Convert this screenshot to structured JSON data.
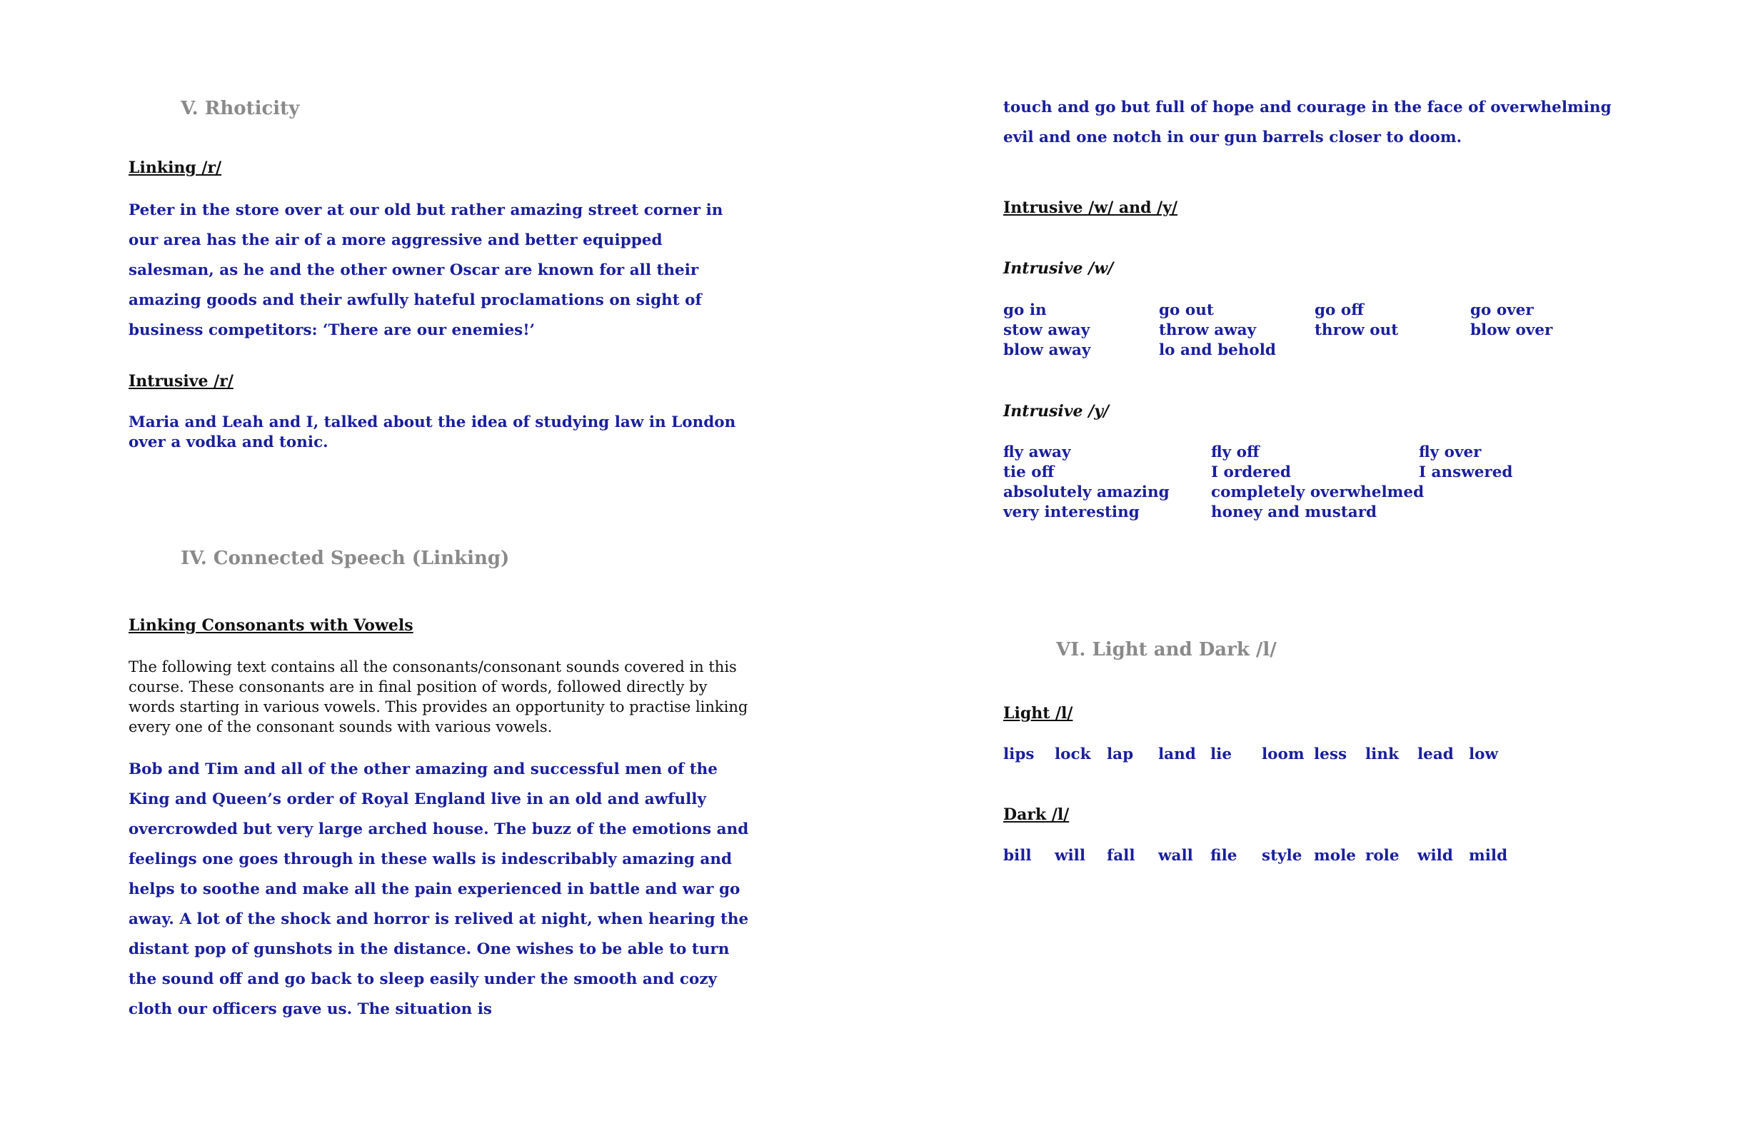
{
  "left": {
    "rhoticity_heading": "V. Rhoticity",
    "linking_r_heading": "Linking /r/",
    "linking_r_text": "Peter in the store over at our old but rather amazing street corner in our area has the air of a more aggressive and better equipped salesman, as he and the other owner Oscar are known for all their amazing goods and their awfully hateful proclamations on sight of business competitors: ‘There are our enemies!’",
    "intrusive_r_heading": "Intrusive /r/",
    "intrusive_r_text": "Maria and Leah and I, talked about the idea of studying law in London over a vodka and tonic.",
    "connected_heading": "IV. Connected Speech (Linking)",
    "linking_cv_heading": "Linking Consonants with Vowels",
    "linking_cv_intro": "The following text contains all the consonants/consonant sounds covered in this course. These consonants are in final position of words, followed directly by words starting in various vowels. This provides an opportunity to practise linking every one of the consonant sounds with various vowels.",
    "linking_cv_text": "Bob and Tim and all of the other amazing and successful men of the King and Queen’s order of Royal England live in an old and awfully overcrowded but very large arched house. The buzz of the emotions and feelings one goes through in these walls is indescribably amazing and helps to soothe and make all the pain experienced in battle and war go away. A lot of the shock and horror is relived at night, when hearing the distant pop of gunshots in the distance. One wishes to be able to turn the sound off and go back to sleep easily under the smooth and cozy cloth our officers gave us. The situation is"
  },
  "right": {
    "continued_text": "touch and go but full of hope and courage in the face of overwhelming evil and one notch in our gun barrels closer to doom.",
    "intrusive_wy_heading": "Intrusive /w/ and /y/",
    "intrusive_w_heading": "Intrusive /w/",
    "intrusive_w_words": [
      "go in",
      "go out",
      "go off",
      "go over",
      "stow away",
      "throw away",
      "throw out",
      "blow over",
      "blow away",
      "lo and behold"
    ],
    "intrusive_y_heading": "Intrusive /y/",
    "intrusive_y_words": [
      "fly away",
      "fly off",
      "fly over",
      "tie off",
      "I ordered",
      "I answered",
      "absolutely amazing",
      "completely overwhelmed",
      "very interesting",
      "honey and mustard"
    ],
    "light_dark_heading": "VI. Light and Dark /l/",
    "light_l_heading": "Light /l/",
    "light_l_words": [
      "lips",
      "lock",
      "lap",
      "land",
      "lie",
      "loom",
      "less",
      "link",
      "lead",
      "low"
    ],
    "dark_l_heading": "Dark /l/",
    "dark_l_words": [
      "bill",
      "will",
      "fall",
      "wall",
      "file",
      "style",
      "mole",
      "role",
      "wild",
      "mild"
    ]
  }
}
